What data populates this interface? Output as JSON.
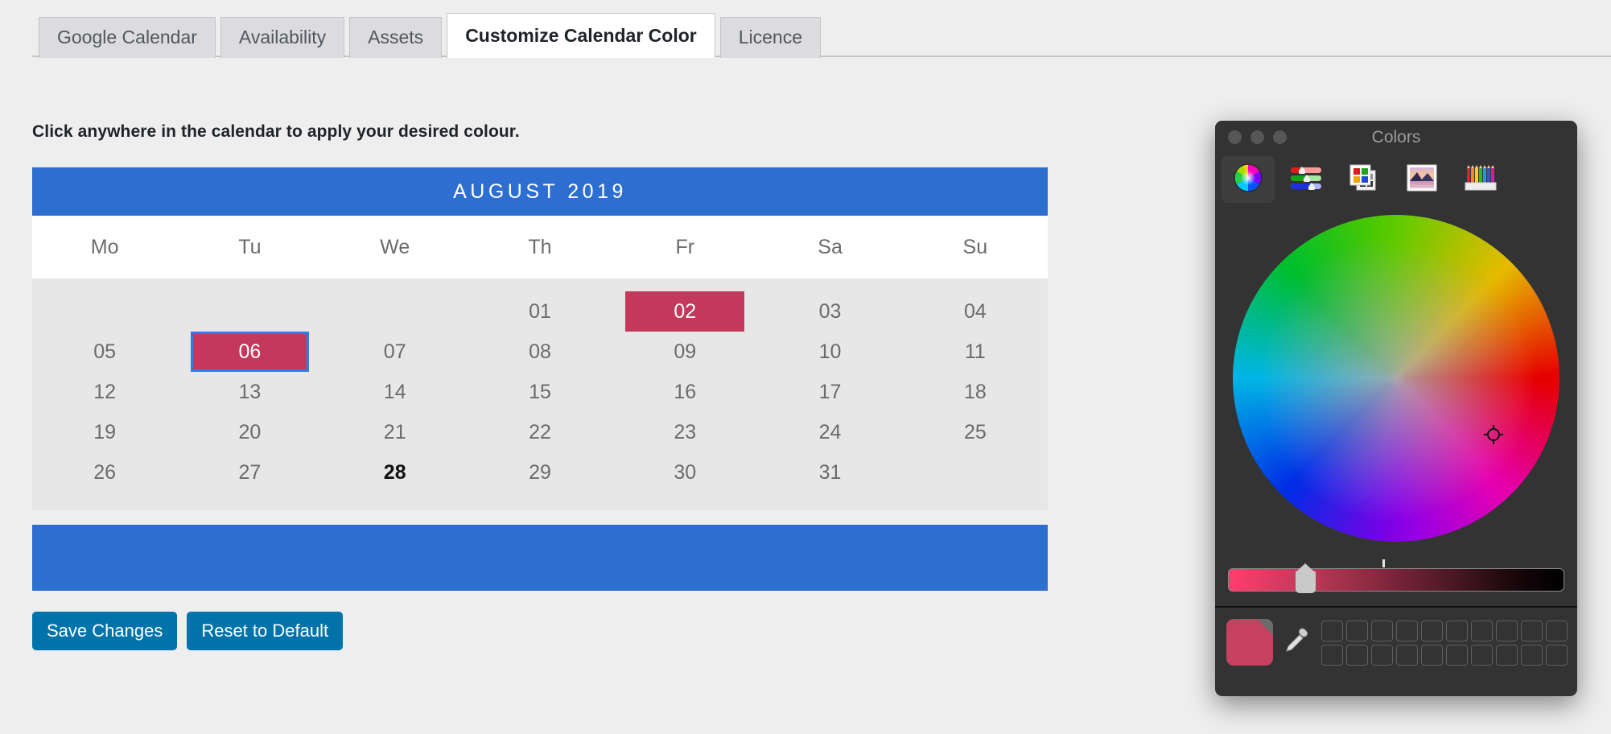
{
  "tabs": [
    {
      "label": "Google Calendar",
      "active": false
    },
    {
      "label": "Availability",
      "active": false
    },
    {
      "label": "Assets",
      "active": false
    },
    {
      "label": "Customize Calendar Color",
      "active": true
    },
    {
      "label": "Licence",
      "active": false
    }
  ],
  "page": {
    "instruction": "Click anywhere in the calendar to apply your desired colour."
  },
  "calendar": {
    "title": "AUGUST 2019",
    "weekdays": [
      "Mo",
      "Tu",
      "We",
      "Th",
      "Fr",
      "Sa",
      "Su"
    ],
    "leading_blanks": 3,
    "days": [
      {
        "label": "01"
      },
      {
        "label": "02",
        "selected": true
      },
      {
        "label": "03"
      },
      {
        "label": "04"
      },
      {
        "label": "05"
      },
      {
        "label": "06",
        "selected": true,
        "focused": true
      },
      {
        "label": "07"
      },
      {
        "label": "08"
      },
      {
        "label": "09"
      },
      {
        "label": "10"
      },
      {
        "label": "11"
      },
      {
        "label": "12"
      },
      {
        "label": "13"
      },
      {
        "label": "14"
      },
      {
        "label": "15"
      },
      {
        "label": "16"
      },
      {
        "label": "17"
      },
      {
        "label": "18"
      },
      {
        "label": "19"
      },
      {
        "label": "20"
      },
      {
        "label": "21"
      },
      {
        "label": "22"
      },
      {
        "label": "23"
      },
      {
        "label": "24"
      },
      {
        "label": "25"
      },
      {
        "label": "26"
      },
      {
        "label": "27"
      },
      {
        "label": "28",
        "today": true
      },
      {
        "label": "29"
      },
      {
        "label": "30"
      },
      {
        "label": "31"
      }
    ],
    "header_color": "#2d6ed1",
    "footer_color": "#2d6ed1",
    "applied_color": "#c4395b",
    "grid_background": "#e7e7e7"
  },
  "buttons": {
    "save": "Save Changes",
    "reset": "Reset to Default",
    "color": "#0073aa"
  },
  "color_panel": {
    "title": "Colors",
    "window_controls": [
      "close-button",
      "minimize-button",
      "zoom-button"
    ],
    "tools": [
      {
        "name": "color-wheel-tool",
        "active": true
      },
      {
        "name": "color-sliders-tool",
        "active": false
      },
      {
        "name": "color-palettes-tool",
        "active": false
      },
      {
        "name": "image-palettes-tool",
        "active": false
      },
      {
        "name": "pencils-tool",
        "active": false
      }
    ],
    "current_color": "#c6405f",
    "brightness_percent": 20,
    "swatch_rows": 2,
    "swatch_columns": 10
  }
}
